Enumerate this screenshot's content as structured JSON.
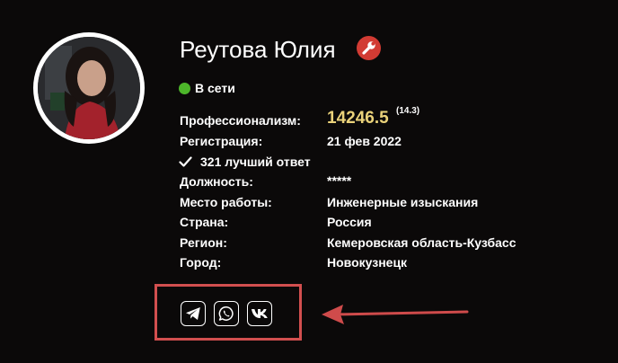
{
  "profile": {
    "name": "Реутова Юлия",
    "status": "В сети",
    "best_answers": "321 лучший ответ",
    "score": "14246.5",
    "score_delta": "(14.3)"
  },
  "fields": [
    {
      "label": "Профессионализм:",
      "value": ""
    },
    {
      "label": "Регистрация:",
      "value": "21 фев 2022"
    },
    {
      "label": "Должность:",
      "value": "*****"
    },
    {
      "label": "Место работы:",
      "value": "Инженерные изыскания"
    },
    {
      "label": "Страна:",
      "value": "Россия"
    },
    {
      "label": "Регион:",
      "value": "Кемеровская область-Кузбасс"
    },
    {
      "label": "Город:",
      "value": "Новокузнецк"
    }
  ],
  "social": [
    "telegram-icon",
    "whatsapp-icon",
    "vk-icon"
  ],
  "colors": {
    "background": "#0b0909",
    "online": "#4db62a",
    "score": "#ead27a",
    "badge": "#d23b33",
    "highlight": "#d24f4f"
  }
}
